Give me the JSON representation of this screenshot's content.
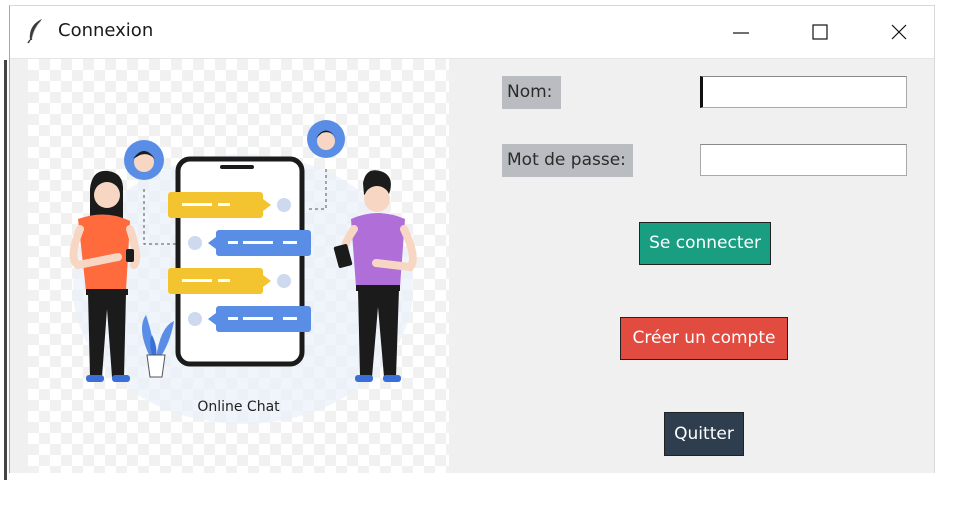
{
  "window": {
    "title": "Connexion",
    "app_icon": "feather-icon",
    "controls": {
      "minimize": "minimize-icon",
      "maximize": "maximize-icon",
      "close": "close-icon"
    }
  },
  "image": {
    "caption": "Online Chat",
    "icon": "online-chat-illustration"
  },
  "form": {
    "name_label": "Nom:",
    "name_value": "",
    "password_label": "Mot de passe:",
    "password_value": ""
  },
  "buttons": {
    "connect_label": "Se connecter",
    "create_label": "Créer un compte",
    "quit_label": "Quitter"
  },
  "colors": {
    "window_bg": "#f0f0f0",
    "label_bg": "#b9bcc1",
    "connect_bg": "#1a9e82",
    "create_bg": "#e24b3f",
    "quit_bg": "#2f3e4f"
  }
}
